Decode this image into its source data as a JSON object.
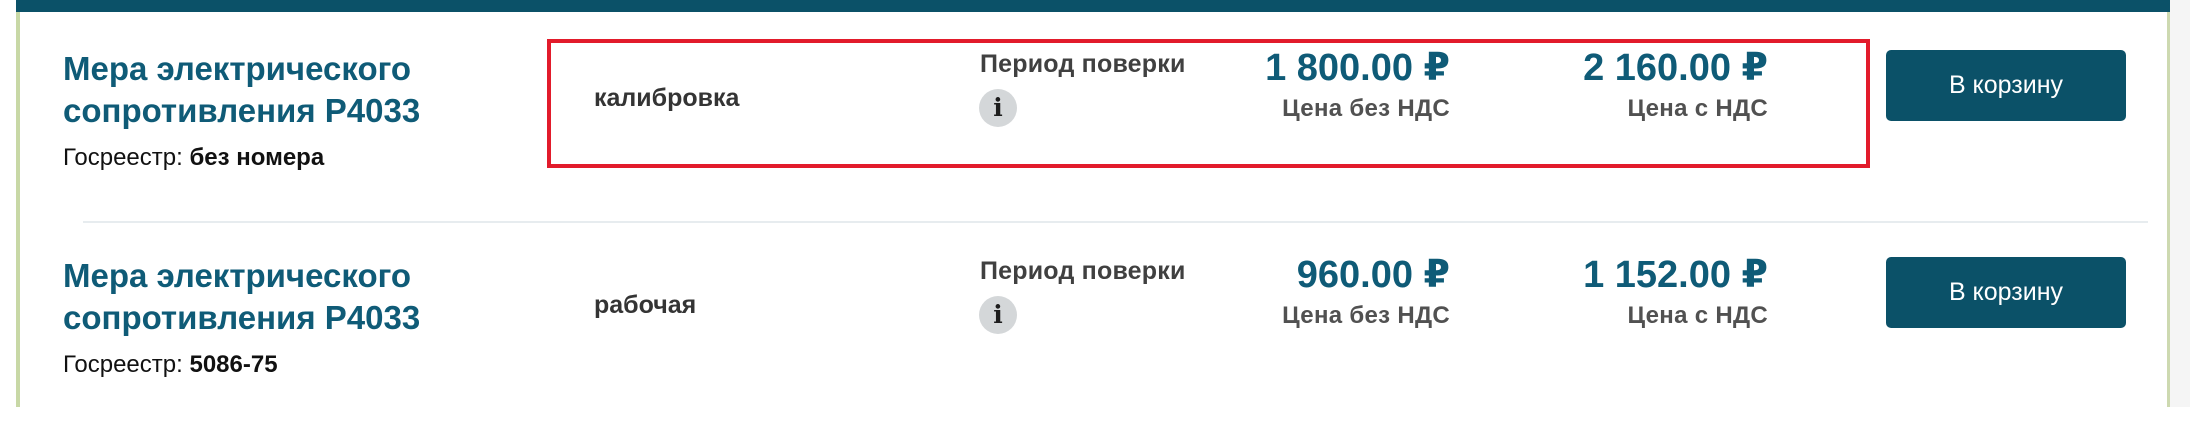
{
  "products": [
    {
      "title": "Мера электрического сопротивления Р4033",
      "registry_label": "Госреестр:",
      "registry_value": "без номера",
      "service_type": "калибровка",
      "period_label": "Период поверки",
      "price_no_vat": "1 800.00 ₽",
      "price_no_vat_caption": "Цена без НДС",
      "price_vat": "2 160.00 ₽",
      "price_vat_caption": "Цена с НДС",
      "cart_label": "В корзину",
      "highlighted": true
    },
    {
      "title": "Мера электрического сопротивления Р4033",
      "registry_label": "Госреестр:",
      "registry_value": "5086-75",
      "service_type": "рабочая",
      "period_label": "Период поверки",
      "price_no_vat": "960.00 ₽",
      "price_no_vat_caption": "Цена без НДС",
      "price_vat": "1 152.00 ₽",
      "price_vat_caption": "Цена с НДС",
      "cart_label": "В корзину",
      "highlighted": false
    }
  ],
  "icons": {
    "info": "i"
  },
  "colors": {
    "accent": "#0b5168",
    "title": "#0f5b77",
    "highlight": "#e21b2b",
    "rail": "#c8d8a6"
  }
}
